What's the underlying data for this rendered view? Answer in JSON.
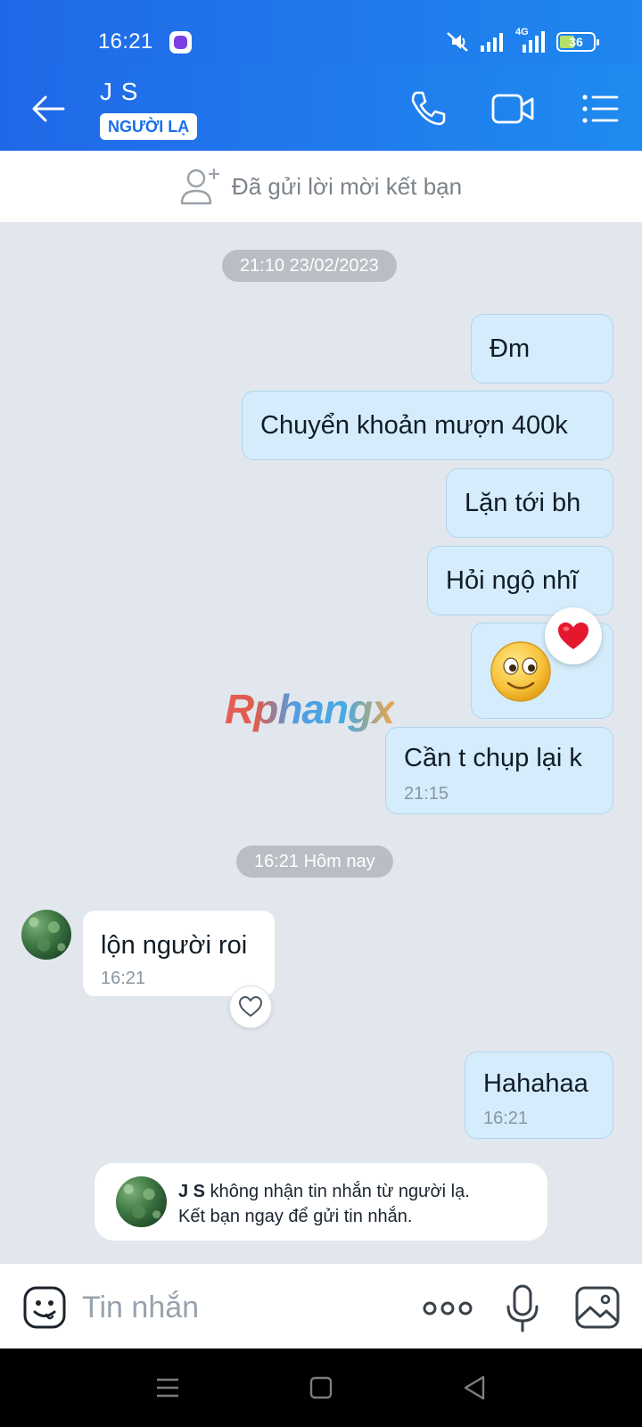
{
  "status_bar": {
    "time": "16:21",
    "battery": "36",
    "network": "4G"
  },
  "header": {
    "name": "J S",
    "badge": "NGƯỜI LẠ"
  },
  "friend_request": {
    "label": "Đã gửi lời mời kết bạn"
  },
  "separators": [
    "21:10 23/02/2023",
    "16:21 Hôm nay"
  ],
  "messages": [
    {
      "from": "me",
      "text": "Đm"
    },
    {
      "from": "me",
      "text": "Chuyển khoản mượn 400k"
    },
    {
      "from": "me",
      "text": "Lặn tới bh"
    },
    {
      "from": "me",
      "text": "Hỏi ngộ nhĩ"
    },
    {
      "from": "me",
      "sticker": "smiley-emoji",
      "reaction": "heart"
    },
    {
      "from": "me",
      "text": "Cần t chụp lại k",
      "time": "21:15"
    },
    {
      "from": "them",
      "text": "lộn người roi",
      "time": "16:21"
    },
    {
      "from": "me",
      "text": "Hahahaa",
      "time": "16:21"
    }
  ],
  "watermark": "Rphangx",
  "notice": {
    "name": "J S",
    "line1_rest": "không nhận tin nhắn từ người lạ.",
    "line2": "Kết bạn ngay để gửi tin nhắn."
  },
  "composer": {
    "placeholder": "Tin nhắn"
  },
  "colors": {
    "accent": "#1f7bef",
    "sent_bubble": "#d4ecfb",
    "chat_bg": "#e2e7ee"
  },
  "icons": [
    "back-arrow-icon",
    "phone-icon",
    "video-camera-icon",
    "list-menu-icon",
    "add-friend-icon",
    "heart-icon",
    "emoji-icon",
    "more-dots-icon",
    "microphone-icon",
    "image-icon"
  ]
}
